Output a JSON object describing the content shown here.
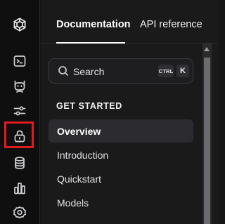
{
  "rail": {
    "icons": [
      "openai-logo-icon",
      "terminal-icon",
      "robot-icon",
      "sliders-icon",
      "lock-icon",
      "database-icon",
      "bar-chart-icon",
      "settings-icon"
    ]
  },
  "tabs": {
    "documentation": "Documentation",
    "api_reference": "API reference"
  },
  "search": {
    "placeholder": "Search",
    "shortcut_ctrl": "CTRL",
    "shortcut_key": "K"
  },
  "sidebar": {
    "section_heading": "GET STARTED",
    "items": [
      {
        "label": "Overview",
        "active": true
      },
      {
        "label": "Introduction",
        "active": false
      },
      {
        "label": "Quickstart",
        "active": false
      },
      {
        "label": "Models",
        "active": false
      }
    ]
  },
  "colors": {
    "highlight": "#e11b22",
    "active_item_bg": "#2c2c30"
  }
}
